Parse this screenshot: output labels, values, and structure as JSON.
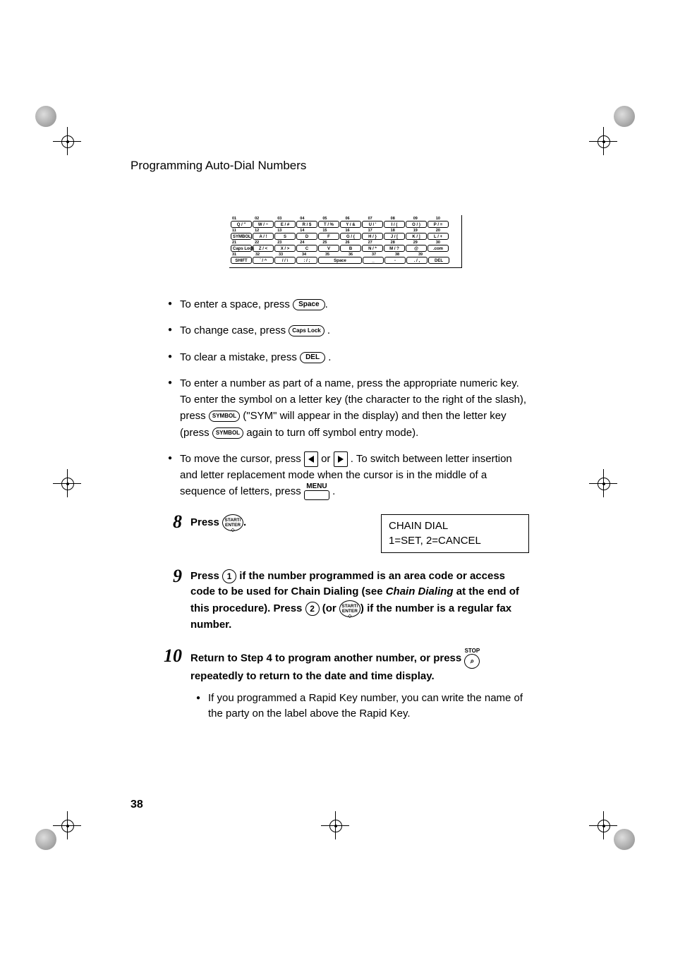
{
  "header": "Programming Auto-Dial Numbers",
  "page_number": "38",
  "keyboard": {
    "row_nums_1": [
      "01",
      "02",
      "03",
      "04",
      "05",
      "06",
      "07",
      "08",
      "09",
      "10"
    ],
    "row1": [
      "Q / \"",
      "W / ~",
      "E / #",
      "R / $",
      "T / %",
      "Y / &",
      "U / '",
      "I / (",
      "O / )",
      "P / ="
    ],
    "row_nums_2": [
      "11",
      "12",
      "13",
      "14",
      "15",
      "16",
      "17",
      "18",
      "19",
      "20"
    ],
    "row2_first": "SYMBOL",
    "row2": [
      "A / !",
      "S",
      "D",
      "F",
      "G / {",
      "H / }",
      "J / [",
      "K / ]",
      "L / +"
    ],
    "row_nums_3": [
      "21",
      "22",
      "23",
      "24",
      "25",
      "26",
      "27",
      "28",
      "29",
      "30"
    ],
    "row3_first": "Caps Lock",
    "row3": [
      "Z / <",
      "X / >",
      "C",
      "V",
      "B",
      "N / *",
      "M / ?",
      "@",
      ".com"
    ],
    "row_nums_4": [
      "31",
      "32",
      "33",
      "34",
      "35",
      "36",
      "37",
      "38",
      "39"
    ],
    "row4_first": "SHIFT",
    "row4": [
      "¨ / ^",
      "/ / \\",
      ": / ;",
      "Space",
      "_",
      "-",
      ". / ,",
      "DEL"
    ]
  },
  "instructions": {
    "i1_a": "To enter a space, press ",
    "i1_key": "Space",
    "i1_b": ".",
    "i2_a": "To change case, press ",
    "i2_key": "Caps Lock",
    "i2_b": " .",
    "i3_a": "To clear a mistake, press ",
    "i3_key": "DEL",
    "i3_b": " .",
    "i4_a": "To enter a number as part of a name, press the appropriate numeric key. To enter the symbol on a letter key (the character to the right of the slash), press ",
    "i4_key1": "SYMBOL",
    "i4_b": " (\"SYM\" will appear in the display) and then the letter key (press ",
    "i4_key2": "SYMBOL",
    "i4_c": " again to turn off symbol entry mode).",
    "i5_a": "To move the cursor, press ",
    "i5_b": " or ",
    "i5_c": " . To switch between letter insertion and letter replacement mode when the cursor is in the middle of a sequence of letters, press ",
    "i5_menu": "MENU",
    "i5_d": " ."
  },
  "step8": {
    "num": "8",
    "text_a": "Press ",
    "key": "START/\nENTER",
    "text_b": ".",
    "display_line1": "CHAIN DIAL",
    "display_line2": "1=SET, 2=CANCEL"
  },
  "step9": {
    "num": "9",
    "text_a": "Press ",
    "key1": "1",
    "text_b": " if the number programmed is an area code or access code to be used for Chain Dialing (see ",
    "em": "Chain Dialing",
    "text_c": " at the end of this procedure). Press ",
    "key2": "2",
    "text_d": " (or ",
    "key3": "START/\nENTER",
    "text_e": ") if the number is a regular fax number."
  },
  "step10": {
    "num": "10",
    "text_a": "Return to Step 4 to program another number, or press ",
    "stop_label": "STOP",
    "text_b": " repeatedly to return to the date and time display.",
    "sub": "If you programmed a Rapid Key number, you can write the name of the party on the label above the Rapid Key."
  }
}
